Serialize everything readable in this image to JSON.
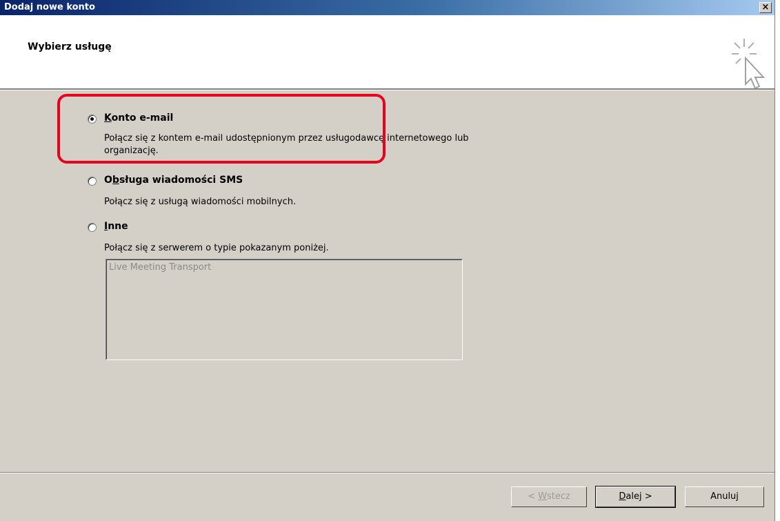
{
  "window": {
    "title": "Dodaj nowe konto",
    "close_label": "×"
  },
  "header": {
    "title": "Wybierz usługę",
    "icon": "cursor-sparkle-icon"
  },
  "options": [
    {
      "label": "Konto e-mail",
      "underline_char": "K",
      "description_line1": "Połącz się z kontem e-mail udostępnionym przez usługodawcę internetowego lub",
      "description_line2": "organizację.",
      "selected": true
    },
    {
      "label": "Obsługa wiadomości SMS",
      "underline_char": "b",
      "description_line1": "Połącz się z usługą wiadomości mobilnych.",
      "selected": false
    },
    {
      "label": "Inne",
      "underline_char": "I",
      "description_line1": "Połącz się z serwerem o typie pokazanym poniżej.",
      "selected": false
    }
  ],
  "server_types": [
    "Live Meeting Transport"
  ],
  "buttons": {
    "back": "< Wstecz",
    "next": "Dalej >",
    "cancel": "Anuluj"
  },
  "colors": {
    "highlight": "#e8001c",
    "dialog_bg": "#d4d0c8",
    "titlebar_start": "#0a246a"
  }
}
